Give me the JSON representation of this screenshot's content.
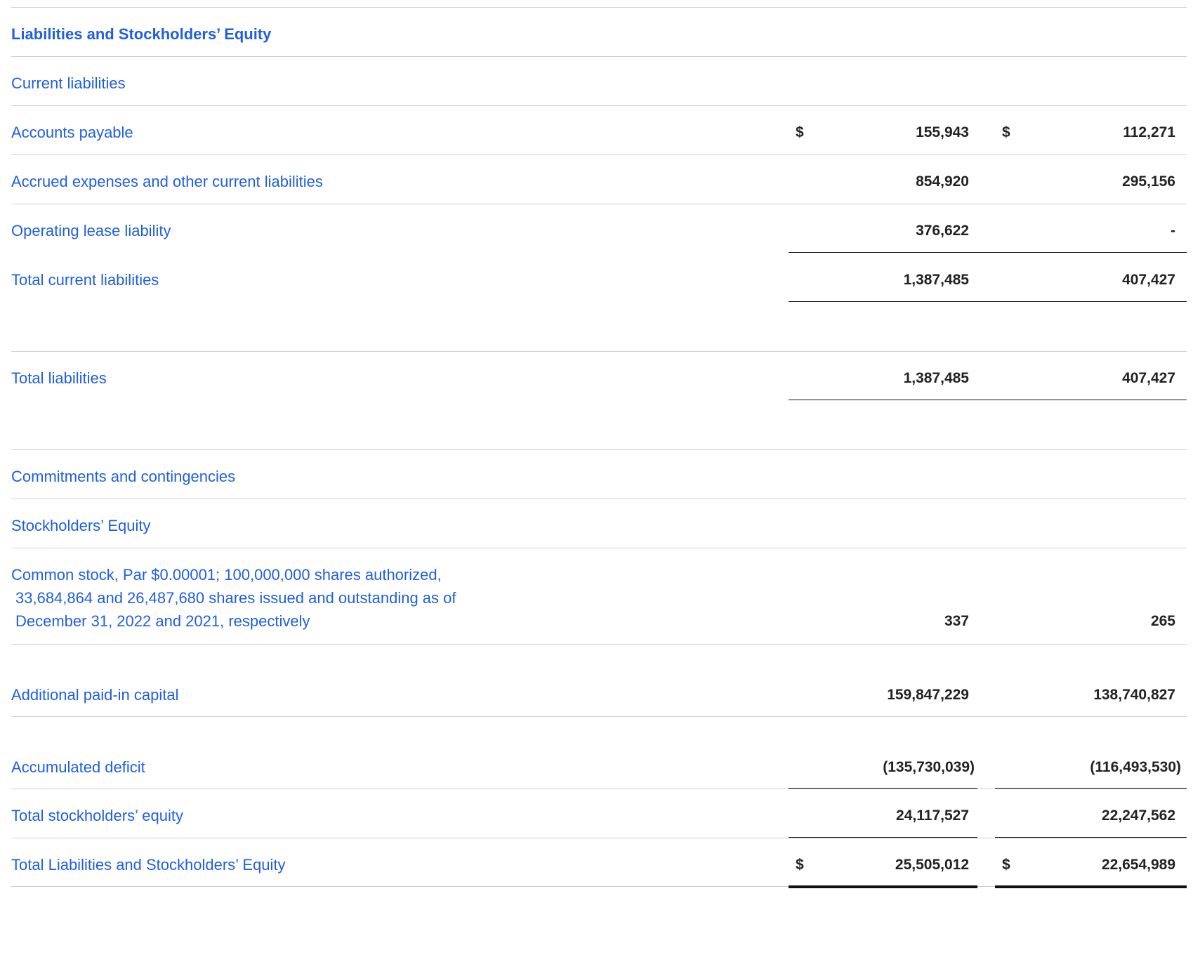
{
  "title": "Liabilities and Stockholders’ Equity",
  "currency_symbol": "$",
  "rows": {
    "current_liabilities": "Current liabilities",
    "accounts_payable": {
      "label": "Accounts payable",
      "v2022": "155,943",
      "v2021": "112,271"
    },
    "accrued_expenses": {
      "label": "Accrued expenses and other current liabilities",
      "v2022": "854,920",
      "v2021": "295,156"
    },
    "operating_lease": {
      "label": "Operating lease liability",
      "v2022": "376,622",
      "v2021": "-"
    },
    "total_current": {
      "label": "Total current liabilities",
      "v2022": "1,387,485",
      "v2021": "407,427"
    },
    "total_liabilities": {
      "label": "Total liabilities",
      "v2022": "1,387,485",
      "v2021": "407,427"
    },
    "commitments": "Commitments and contingencies",
    "stockholders_equity": "Stockholders’ Equity",
    "common_stock": {
      "label_line1": "Common stock, Par $0.00001; 100,000,000 shares authorized,",
      "label_line2": "33,684,864 and 26,487,680 shares issued and outstanding as of",
      "label_line3": "December 31, 2022 and 2021, respectively",
      "v2022": "337",
      "v2021": "265"
    },
    "apic": {
      "label": "Additional paid-in capital",
      "v2022": "159,847,229",
      "v2021": "138,740,827"
    },
    "accumulated_deficit": {
      "label": "Accumulated deficit",
      "v2022": "(135,730,039)",
      "v2021": "(116,493,530)"
    },
    "total_equity": {
      "label": "Total stockholders’ equity",
      "v2022": "24,117,527",
      "v2021": "22,247,562"
    },
    "total_liab_equity": {
      "label": "Total Liabilities and Stockholders’ Equity",
      "v2022": "25,505,012",
      "v2021": "22,654,989"
    }
  }
}
